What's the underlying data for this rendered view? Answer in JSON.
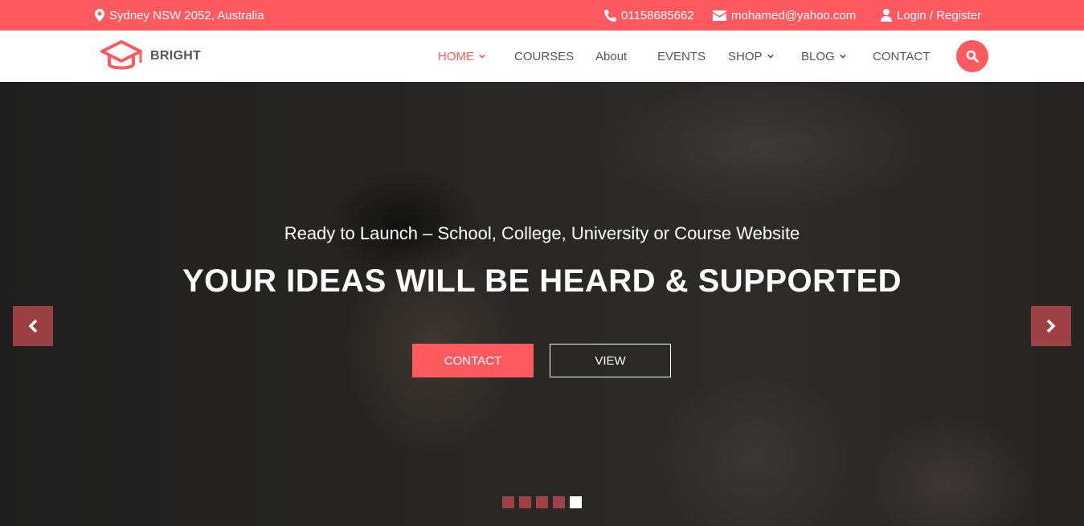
{
  "topbar": {
    "address": "Sydney NSW 2052, Australia",
    "phone": "01158685662",
    "email": "mohamed@yahoo.com",
    "login": "Login",
    "separator": " / ",
    "register": "Register"
  },
  "brand": {
    "name": "BRIGHT"
  },
  "nav": {
    "items": [
      {
        "label": "HOME",
        "active": true,
        "has_dropdown": true
      },
      {
        "label": "COURSES",
        "has_dropdown": false
      },
      {
        "label": "About",
        "has_dropdown": false
      },
      {
        "label": "EVENTS",
        "has_dropdown": false
      },
      {
        "label": "SHOP",
        "has_dropdown": true
      },
      {
        "label": "BLOG",
        "has_dropdown": true
      },
      {
        "label": "CONTACT",
        "has_dropdown": false
      }
    ]
  },
  "hero": {
    "subtitle": "Ready to Launch – School, College, University or Course Website",
    "title": "YOUR IDEAS WILL BE HEARD & SUPPORTED",
    "primary_button": "CONTACT",
    "secondary_button": "VIEW",
    "slides_total": 5,
    "active_slide": 5
  },
  "colors": {
    "accent": "#ff5a5f",
    "nav_text": "#555555"
  }
}
